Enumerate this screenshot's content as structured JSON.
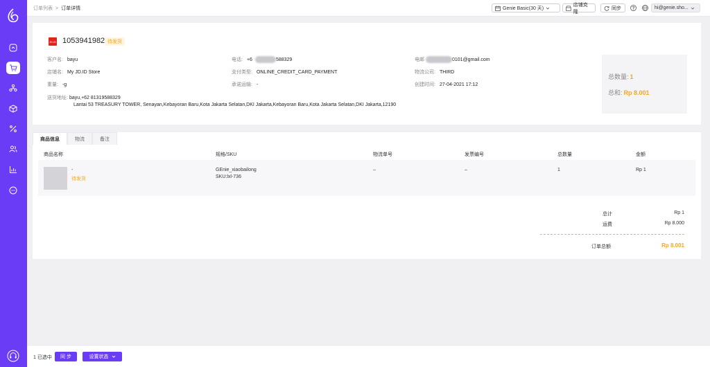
{
  "breadcrumb": {
    "parent": "订单列表",
    "separator": ">",
    "current": "订单详情"
  },
  "toolbar": {
    "plan_label": "Genie Basic(30 天)",
    "clone_label": "店铺克隆",
    "sync_label": "同步",
    "account_label": "hi@genie.sho...",
    "plan_icon": "calendar-icon",
    "clone_icon": "store-icon",
    "sync_icon": "refresh-icon"
  },
  "order": {
    "id": "1053941982",
    "status": "待发货",
    "platform_logo_text": "JD.ID",
    "fields": {
      "customer_label": "客户名:",
      "customer": "bayu",
      "phone_label": "电话:",
      "phone_prefix": "+6",
      "phone_suffix": "588329",
      "email_label": "电邮",
      "email_suffix": "0101@gmail.com",
      "store_label": "店铺名:",
      "store": "My JD.ID Store",
      "payment_label": "支付类型:",
      "payment": "ONLINE_CREDIT_CARD_PAYMENT",
      "logistics_label": "物流公司:",
      "logistics": "THIRD",
      "weight_label": "重量:",
      "weight": "-g",
      "carrier_label": "承诺运输:",
      "carrier": "-",
      "created_label": "创建时间:",
      "created": "27-04-2021 17:12",
      "address_label": "送货地址:",
      "address_line1": "bayu,+62 81319588329",
      "address_line2": "Lantai 53 TREASURY TOWER, Senayan,Kebayoran Baru,Kota Jakarta Selatan,DKI Jakarta,Kebayoran Baru,Kota Jakarta Selatan,DKI Jakarta,12190"
    }
  },
  "summary": {
    "qty_label": "总数量:",
    "qty": "1",
    "total_label": "总和:",
    "total": "Rp 8.001"
  },
  "tabs": [
    {
      "label": "商品信息"
    },
    {
      "label": "物流"
    },
    {
      "label": "备注"
    }
  ],
  "table": {
    "headers": [
      "商品名称",
      "规格/SKU",
      "物流单号",
      "发票编号",
      "总数量",
      "金额"
    ],
    "rows": [
      {
        "name": "-",
        "status": "待发货",
        "spec": "GEnie_xiaobailong",
        "sku": "SKU:lxl-736",
        "tracking": "–",
        "invoice": "–",
        "qty": "1",
        "amount": "Rp 1"
      }
    ]
  },
  "totals": {
    "subtotal_label": "总计",
    "subtotal": "Rp 1",
    "shipping_label": "运费",
    "shipping": "Rp 8.000",
    "grand_label": "订单总额",
    "grand": "Rp 8.001"
  },
  "bottom": {
    "selected": "1 已选中",
    "sync_button": "同 步",
    "status_button": "设置状态"
  },
  "colors": {
    "brand": "#6a3cf5",
    "accent": "#f5a623",
    "jd_red": "#e1251b"
  },
  "sidebar": {
    "items": [
      {
        "icon": "dashboard-icon"
      },
      {
        "icon": "cart-icon",
        "active": true
      },
      {
        "icon": "org-icon"
      },
      {
        "icon": "box-icon"
      },
      {
        "icon": "percent-icon"
      },
      {
        "icon": "users-icon"
      },
      {
        "icon": "chart-icon"
      },
      {
        "icon": "chat-icon"
      }
    ]
  }
}
